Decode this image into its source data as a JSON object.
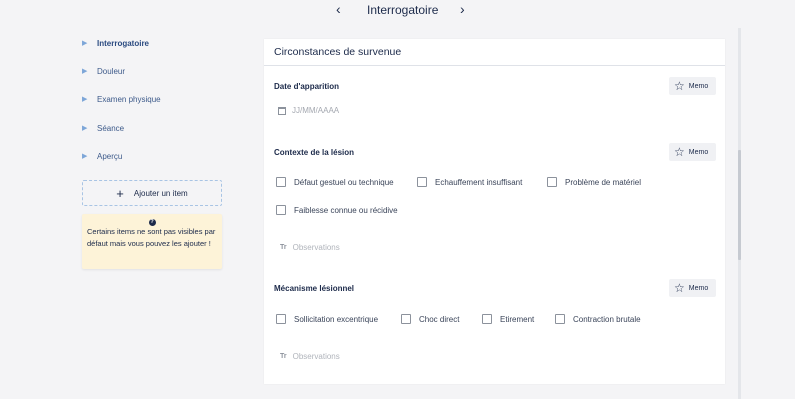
{
  "header": {
    "title": "Interrogatoire",
    "prev_icon": "chevron-left-icon",
    "next_icon": "chevron-right-icon"
  },
  "sidebar": {
    "items": [
      {
        "label": "Interrogatoire",
        "active": true
      },
      {
        "label": "Douleur",
        "active": false
      },
      {
        "label": "Examen physique",
        "active": false
      },
      {
        "label": "Séance",
        "active": false
      },
      {
        "label": "Aperçu",
        "active": false
      }
    ],
    "add_label": "Ajouter un item",
    "info_text": "Certains items ne sont pas visibles par défaut mais vous pouvez les ajouter !"
  },
  "card": {
    "title": "Circonstances de survenue",
    "memo_label": "Memo",
    "date_section": {
      "label": "Date d'apparition",
      "placeholder": "JJ/MM/AAAA"
    },
    "contexte_section": {
      "label": "Contexte de la lésion",
      "options": [
        "Défaut gestuel ou technique",
        "Echauffement insuffisant",
        "Problème de matériel",
        "Faiblesse connue ou récidive"
      ],
      "observations_placeholder": "Observations"
    },
    "mecanisme_section": {
      "label": "Mécanisme lésionnel",
      "options": [
        "Sollicitation excentrique",
        "Choc direct",
        "Etirement",
        "Contraction brutale"
      ],
      "observations_placeholder": "Observations"
    }
  },
  "colors": {
    "background": "#f4f4f6",
    "card": "#ffffff",
    "info_bg": "#fdf3d8",
    "accent": "#3d5a8a",
    "dashed_border": "#a8c4e4"
  }
}
